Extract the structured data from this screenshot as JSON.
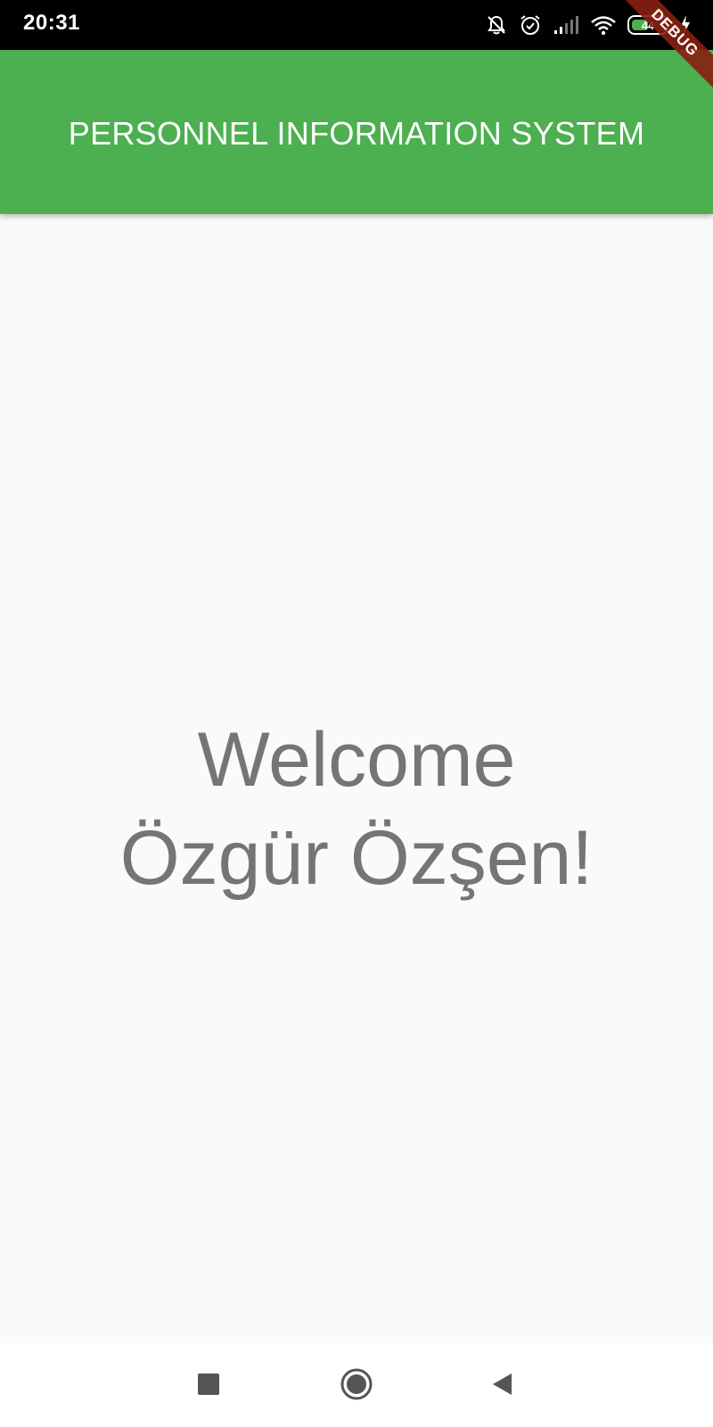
{
  "status_bar": {
    "time": "20:31",
    "battery_level": "44",
    "icons": [
      "mute-icon",
      "alarm-icon",
      "cell-signal-icon",
      "wifi-icon",
      "battery-icon",
      "charging-icon"
    ]
  },
  "debug_banner": {
    "label": "DEBUG"
  },
  "app_bar": {
    "title": "PERSONNEL INFORMATION SYSTEM",
    "color": "#4caf50"
  },
  "main": {
    "welcome_line": "Welcome",
    "user_line": "Özgür Özşen!",
    "text_color": "#757575"
  },
  "nav_bar": {
    "buttons": [
      "recents-icon",
      "home-icon",
      "back-icon"
    ]
  }
}
